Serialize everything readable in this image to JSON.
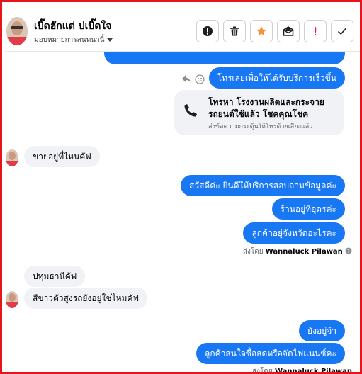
{
  "header": {
    "name": "เบิ๊ดฮักแต่ บ่เบิ๊ดใจ",
    "assign_label": "มอบหมายการสนทนานี้"
  },
  "chat": {
    "card": {
      "title_line1": "โทรหา โรงงานผลิตและกระจาย",
      "title_line2": "รถยนต์ใช้แล้ว โชคคุณโชค",
      "subtitle": "ส่งข้อความกระตุ้นให้โทรด้วยเสียงแล้ว"
    },
    "messages": {
      "m1": "โทรเลยเพื่อให้ได้รับบริการเร็วขึ้น",
      "m2": "ขายอยู่ที่ไหนคัฟ",
      "m3": "สวัสดีค่ะ  ยินดีให้บริการสอบถามข้อมูลค่ะ",
      "m4": "ร้านอยู่ที่อุดรค่ะ",
      "m5": "ลูกค้าอยู่จังหวัดอะไรคะ",
      "m6": "ปทุมธานีคัฟ",
      "m7": "สีขาวตัวสูงรถยังอยู่ใช่ไหมคัฟ",
      "m8": "ยังอยู่จ้า",
      "m9": "ลูกค้าสนใจซื้อสดหรือจัดไฟแนนซ์คะ"
    },
    "sent_by_prefix": "ส่งโดย",
    "sent_by_name": "Wannaluck Pilawan"
  },
  "colors": {
    "accent": "#1877f2",
    "frame": "#e8141b",
    "star": "#f7923a",
    "alert": "#e41e3f"
  }
}
